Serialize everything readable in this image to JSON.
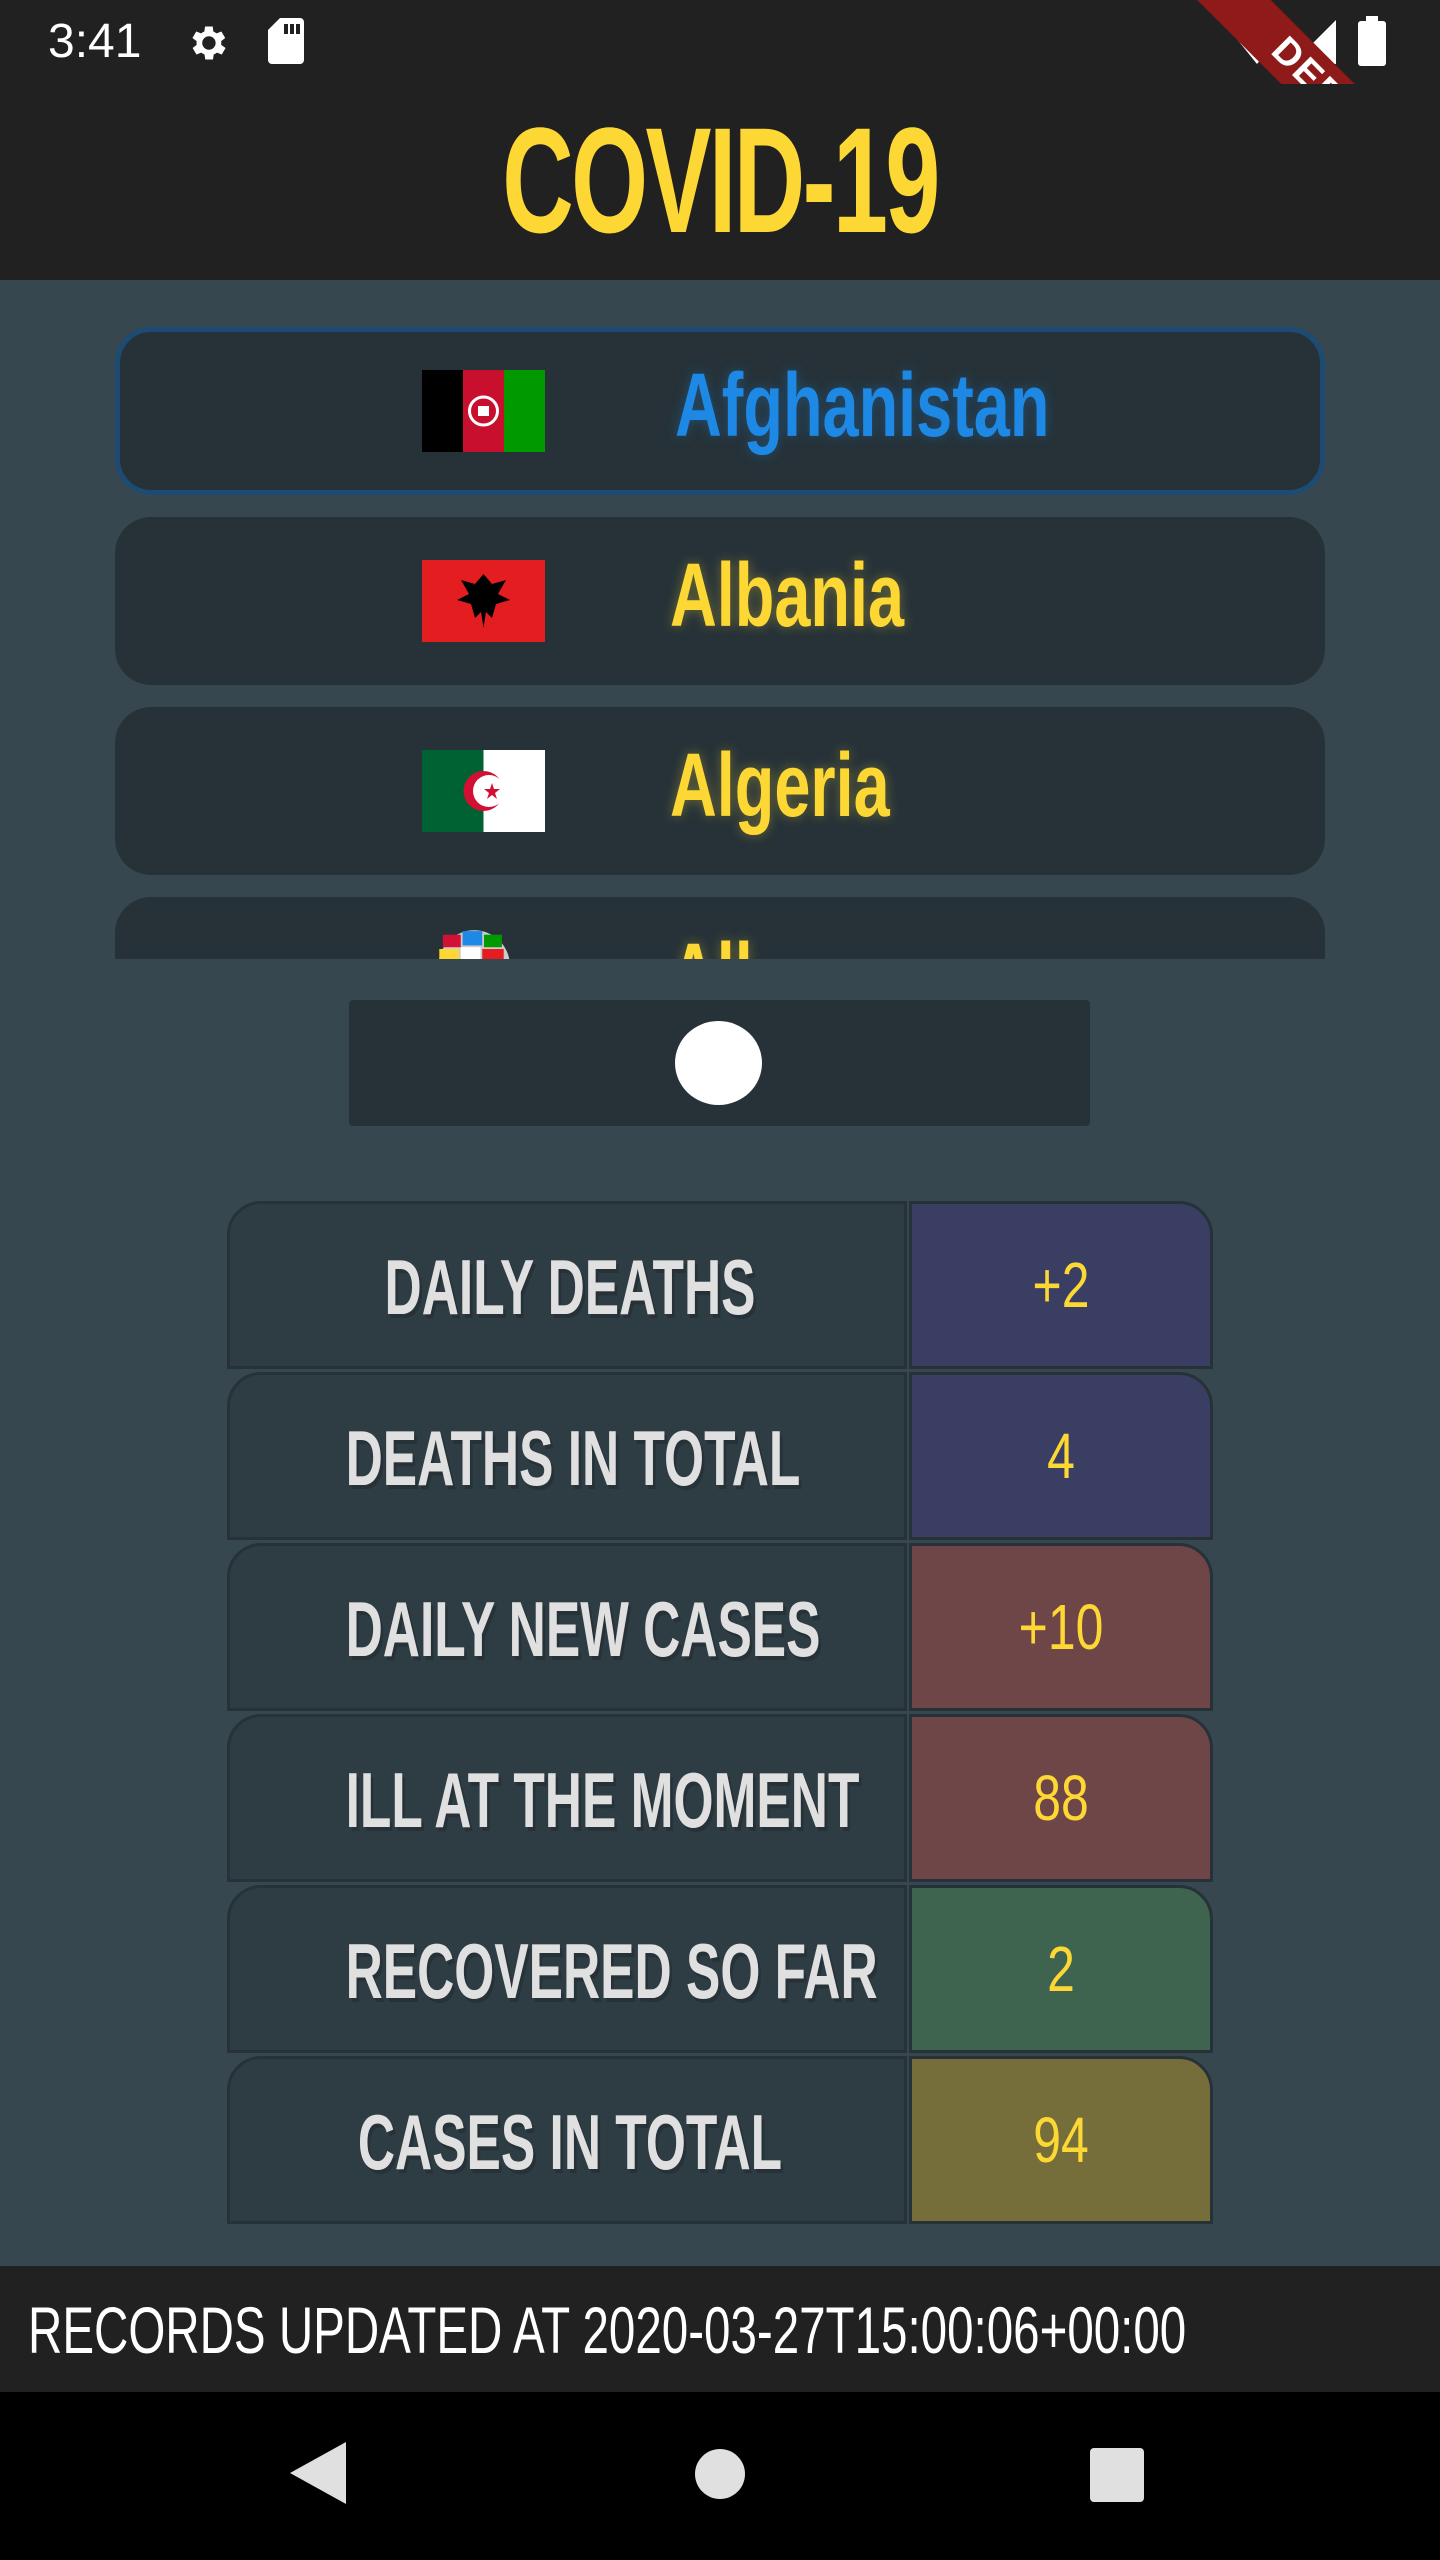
{
  "status_bar": {
    "time": "3:41",
    "debug_label": "DEBUG"
  },
  "app": {
    "title": "COVID-19"
  },
  "countries": [
    {
      "name": "Afghanistan",
      "flag": "afghanistan-flag",
      "selected": true
    },
    {
      "name": "Albania",
      "flag": "albania-flag",
      "selected": false
    },
    {
      "name": "Algeria",
      "flag": "algeria-flag",
      "selected": false
    },
    {
      "name": "All",
      "flag": "world-globe-icon",
      "selected": false
    }
  ],
  "stats": [
    {
      "label": "DAILY DEATHS",
      "value": "+2",
      "color": "#3a3e63"
    },
    {
      "label": "DEATHS IN TOTAL",
      "value": "4",
      "color": "#3a3e63"
    },
    {
      "label": "DAILY NEW CASES",
      "value": "+10",
      "color": "#6f4648"
    },
    {
      "label": "ILL AT THE MOMENT",
      "value": "88",
      "color": "#6f4648"
    },
    {
      "label": "RECOVERED SO FAR",
      "value": "2",
      "color": "#3e6450"
    },
    {
      "label": "CASES IN TOTAL",
      "value": "94",
      "color": "#756e3a"
    }
  ],
  "footer": {
    "text": "RECORDS UPDATED AT 2020-03-27T15:00:06+00:00"
  },
  "colors": {
    "accent": "#fdd835",
    "selected": "#1e88e5",
    "background": "#37474f",
    "card": "#263238"
  }
}
